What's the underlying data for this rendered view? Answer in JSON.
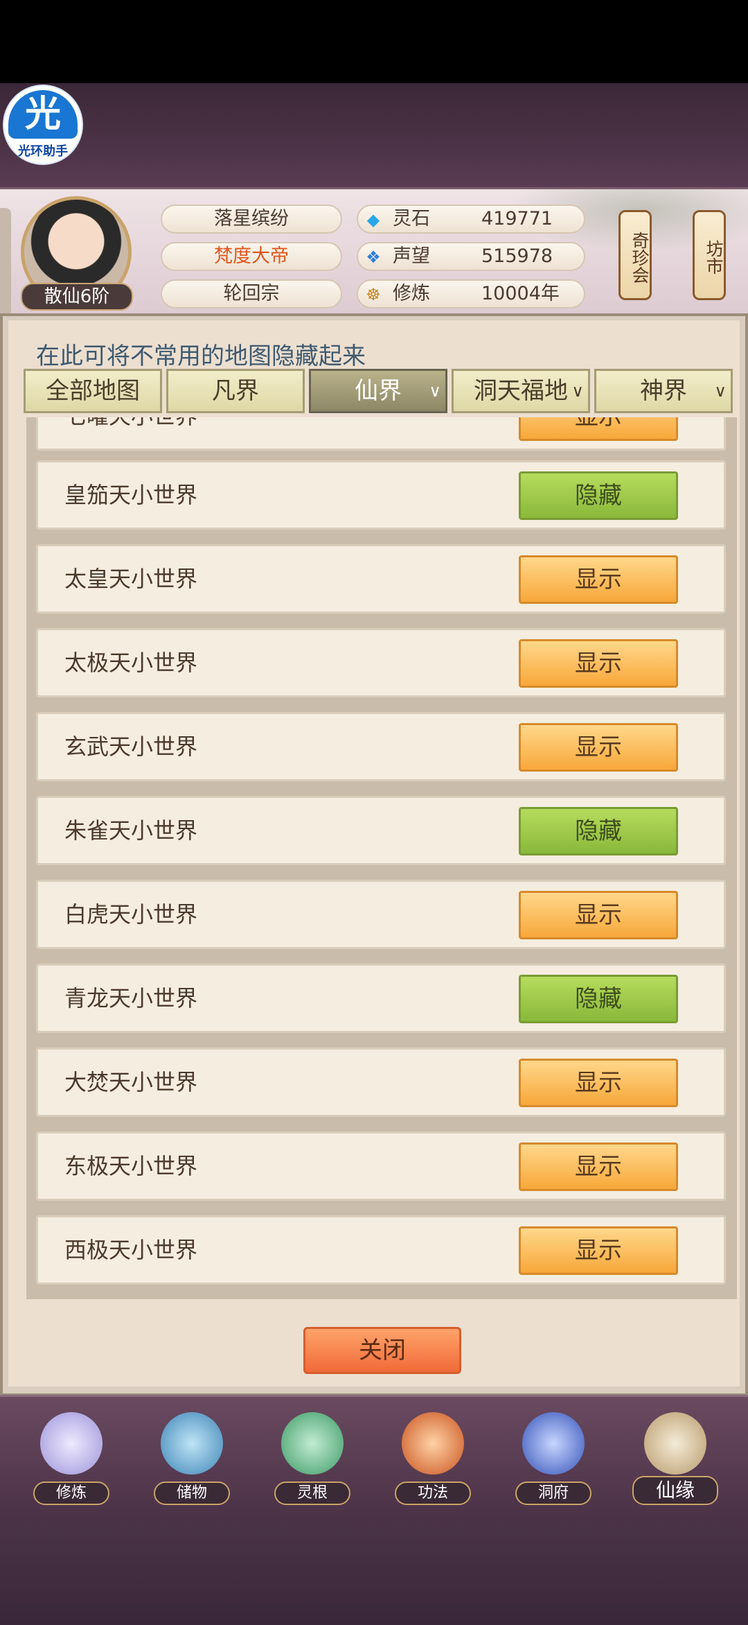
{
  "overlay_badge": {
    "glyph": "光",
    "label": "光环助手"
  },
  "header": {
    "realm": "散仙6阶",
    "player_name": "落星缤纷",
    "title": "梵度大帝",
    "sect": "轮回宗",
    "resources": [
      {
        "icon": "gem-icon",
        "glyph": "◆",
        "label": "灵石",
        "value": "419771"
      },
      {
        "icon": "crystal-icon",
        "glyph": "❖",
        "label": "声望",
        "value": "515978"
      },
      {
        "icon": "meditation-icon",
        "glyph": "☸",
        "label": "修炼",
        "value": "10004年"
      }
    ],
    "side_buttons": [
      "奇珍会",
      "坊市"
    ]
  },
  "panel": {
    "info": "在此可将不常用的地图隐藏起来",
    "tabs": [
      {
        "label": "全部地图",
        "chevron": ""
      },
      {
        "label": "凡界",
        "chevron": ""
      },
      {
        "label": "仙界",
        "chevron": "∨"
      },
      {
        "label": "洞天福地",
        "chevron": "∨"
      },
      {
        "label": "神界",
        "chevron": "∨"
      }
    ],
    "active_tab": "仙界",
    "rows": [
      {
        "name": "七曜天小世界",
        "action": "显示",
        "state": "show"
      },
      {
        "name": "皇笳天小世界",
        "action": "隐藏",
        "state": "hide"
      },
      {
        "name": "太皇天小世界",
        "action": "显示",
        "state": "show"
      },
      {
        "name": "太极天小世界",
        "action": "显示",
        "state": "show"
      },
      {
        "name": "玄武天小世界",
        "action": "显示",
        "state": "show"
      },
      {
        "name": "朱雀天小世界",
        "action": "隐藏",
        "state": "hide"
      },
      {
        "name": "白虎天小世界",
        "action": "显示",
        "state": "show"
      },
      {
        "name": "青龙天小世界",
        "action": "隐藏",
        "state": "hide"
      },
      {
        "name": "大焚天小世界",
        "action": "显示",
        "state": "show"
      },
      {
        "name": "东极天小世界",
        "action": "显示",
        "state": "show"
      },
      {
        "name": "西极天小世界",
        "action": "显示",
        "state": "show"
      }
    ],
    "close_label": "关闭"
  },
  "bottom_nav": [
    {
      "label": "修炼",
      "icon": "lotus-icon",
      "color": "#c9c3f0"
    },
    {
      "label": "储物",
      "icon": "bag-icon",
      "color": "#6fb0d8"
    },
    {
      "label": "灵根",
      "icon": "spirit-root-icon",
      "color": "#6bbf8e"
    },
    {
      "label": "功法",
      "icon": "technique-icon",
      "color": "#e07a3a"
    },
    {
      "label": "洞府",
      "icon": "cave-ring-icon",
      "color": "#5a7be0"
    },
    {
      "label": "仙缘",
      "icon": "scroll-icon",
      "color": "#d9c9a8"
    }
  ]
}
